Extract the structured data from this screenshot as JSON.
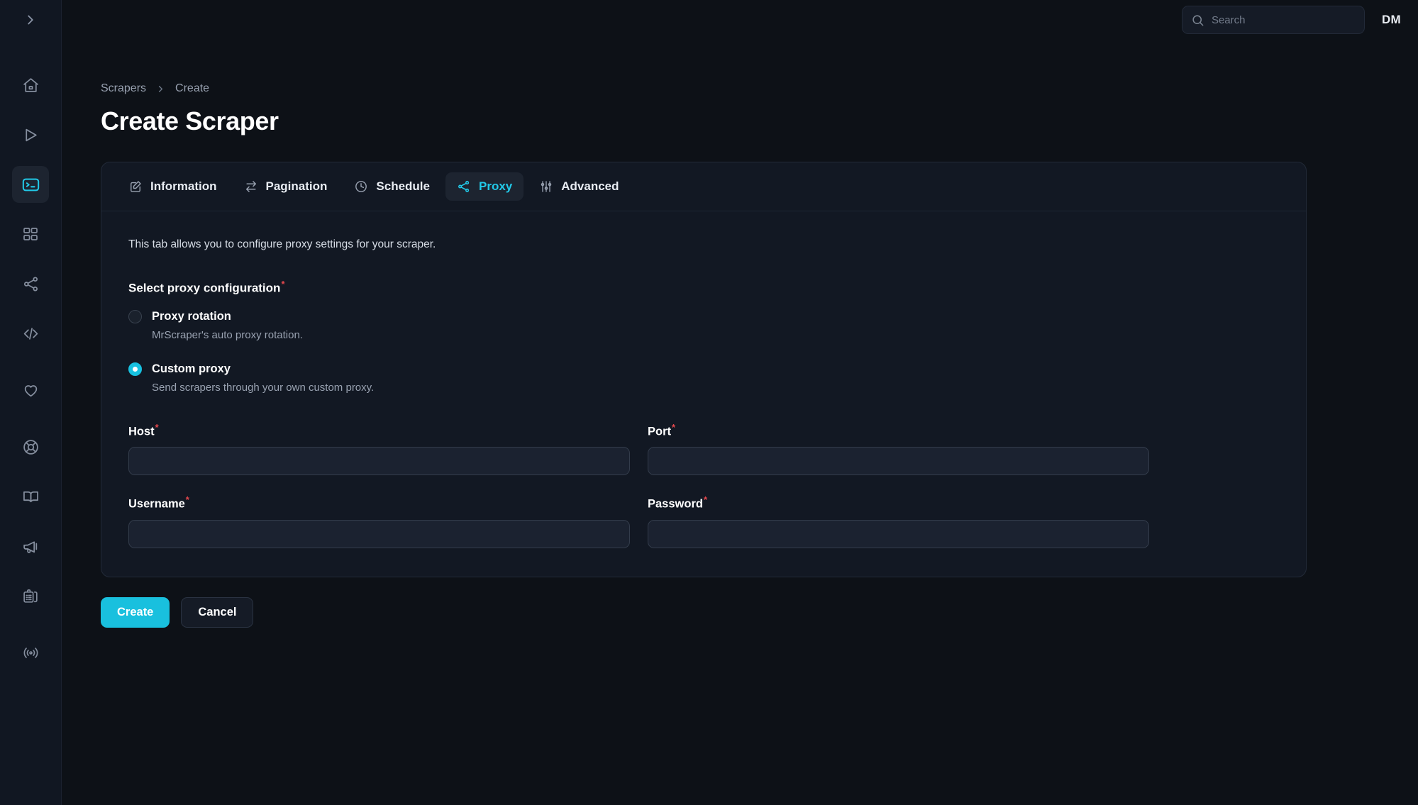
{
  "colors": {
    "page_bg": "#0d1117",
    "rail_bg": "#111722",
    "card_bg": "#121823",
    "accent": "#19c0de",
    "accent_text": "#22c9e8",
    "required_red": "#e5484d",
    "input_bg": "#1b2230"
  },
  "sidebar": {
    "toggle": {
      "icon": "chevron-right-icon"
    },
    "items": [
      {
        "icon": "home-icon",
        "name": "home",
        "active": false
      },
      {
        "icon": "play-icon",
        "name": "runs",
        "active": false
      },
      {
        "icon": "terminal-icon",
        "name": "scrapers",
        "active": true
      },
      {
        "icon": "grid-icon",
        "name": "templates",
        "active": false
      },
      {
        "icon": "share-icon",
        "name": "integrations",
        "active": false
      },
      {
        "icon": "code-icon",
        "name": "api",
        "active": false
      },
      {
        "icon": "heart-icon",
        "name": "favorites",
        "active": false
      },
      {
        "icon": "lifebuoy-icon",
        "name": "support",
        "active": false
      },
      {
        "icon": "book-icon",
        "name": "docs",
        "active": false
      },
      {
        "icon": "megaphone-icon",
        "name": "announcements",
        "active": false
      },
      {
        "icon": "clipboard-list-icon",
        "name": "logs",
        "active": false
      },
      {
        "icon": "broadcast-icon",
        "name": "status",
        "active": false
      }
    ]
  },
  "topbar": {
    "search": {
      "icon": "search-icon",
      "placeholder": "Search",
      "value": ""
    },
    "avatar_initials": "DM"
  },
  "breadcrumb": {
    "items": [
      "Scrapers",
      "Create"
    ],
    "separator_icon": "chevron-right-icon"
  },
  "page": {
    "title": "Create Scraper"
  },
  "tabs": [
    {
      "label": "Information",
      "icon": "edit-square-icon",
      "active": false
    },
    {
      "label": "Pagination",
      "icon": "arrows-swap-icon",
      "active": false
    },
    {
      "label": "Schedule",
      "icon": "clock-icon",
      "active": false
    },
    {
      "label": "Proxy",
      "icon": "share-nodes-icon",
      "active": true
    },
    {
      "label": "Advanced",
      "icon": "sliders-icon",
      "active": false
    }
  ],
  "proxy_tab": {
    "description": "This tab allows you to configure proxy settings for your scraper.",
    "section_label": "Select proxy configuration",
    "section_required": "*",
    "options": [
      {
        "label": "Proxy rotation",
        "sublabel": "MrScraper's auto proxy rotation.",
        "selected": false
      },
      {
        "label": "Custom proxy",
        "sublabel": "Send scrapers through your own custom proxy.",
        "selected": true
      }
    ],
    "fields": [
      {
        "label": "Host",
        "required": "*",
        "value": "",
        "placeholder": "",
        "type": "text"
      },
      {
        "label": "Port",
        "required": "*",
        "value": "",
        "placeholder": "",
        "type": "text"
      },
      {
        "label": "Username",
        "required": "*",
        "value": "",
        "placeholder": "",
        "type": "text"
      },
      {
        "label": "Password",
        "required": "*",
        "value": "",
        "placeholder": "",
        "type": "password"
      }
    ]
  },
  "actions": {
    "create_label": "Create",
    "cancel_label": "Cancel"
  }
}
